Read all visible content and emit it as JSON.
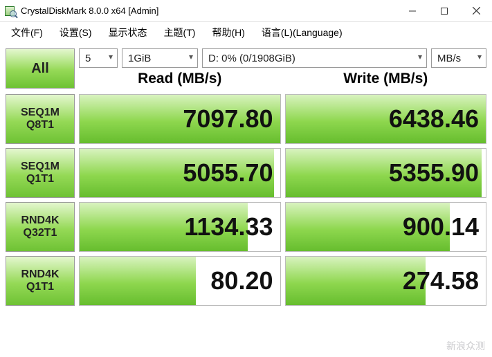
{
  "window": {
    "title": "CrystalDiskMark 8.0.0 x64 [Admin]"
  },
  "menu": {
    "file": "文件(F)",
    "settings": "设置(S)",
    "profile": "显示状态",
    "theme": "主题(T)",
    "help": "帮助(H)",
    "language": "语言(L)(Language)"
  },
  "controls": {
    "all": "All",
    "loops": "5",
    "size": "1GiB",
    "drive": "D: 0% (0/1908GiB)",
    "unit": "MB/s"
  },
  "headers": {
    "read": "Read (MB/s)",
    "write": "Write (MB/s)"
  },
  "tests": [
    {
      "name1": "SEQ1M",
      "name2": "Q8T1",
      "read": "7097.80",
      "write": "6438.46",
      "rbar": 100,
      "wbar": 100
    },
    {
      "name1": "SEQ1M",
      "name2": "Q1T1",
      "read": "5055.70",
      "write": "5355.90",
      "rbar": 97,
      "wbar": 98
    },
    {
      "name1": "RND4K",
      "name2": "Q32T1",
      "read": "1134.33",
      "write": "900.14",
      "rbar": 84,
      "wbar": 82
    },
    {
      "name1": "RND4K",
      "name2": "Q1T1",
      "read": "80.20",
      "write": "274.58",
      "rbar": 58,
      "wbar": 70
    }
  ],
  "watermark": "新浪众测"
}
